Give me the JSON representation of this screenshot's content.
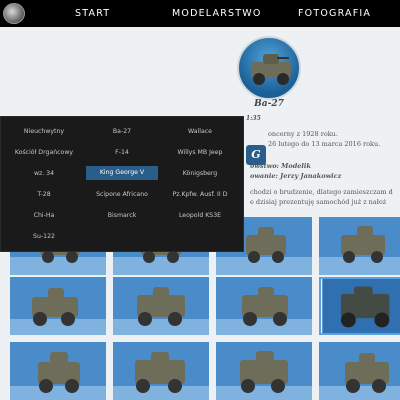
{
  "nav": {
    "items": [
      {
        "label": "START"
      },
      {
        "label": "MODELARSTWO"
      },
      {
        "label": "FOTOGRAFIA"
      }
    ]
  },
  "article": {
    "title": "Ba-27",
    "scale": "1:35",
    "badge": "G",
    "lines": [
      "oncerny z 1928 roku.",
      "26 lutego do 13 marca 2016 roku.",
      "owstwo: Modelik",
      "owanie: Jerzy Janakowicz",
      "chodzi o brudzenie, dlatego zamieszczam d",
      "e dzisiaj prezentuję samochód już z nałoż"
    ]
  },
  "dropdown": {
    "items": [
      {
        "label": "Nieuchwytny",
        "active": false
      },
      {
        "label": "Ba-27",
        "active": false
      },
      {
        "label": "Wallace",
        "active": false
      },
      {
        "label": "Kościół Drgańcowy",
        "active": false
      },
      {
        "label": "F-14",
        "active": false
      },
      {
        "label": "Willys MB Jeep",
        "active": false
      },
      {
        "label": "wz. 34",
        "active": false
      },
      {
        "label": "King George V",
        "active": true
      },
      {
        "label": "Königsberg",
        "active": false
      },
      {
        "label": "T-28",
        "active": false
      },
      {
        "label": "Scipone Africano",
        "active": false
      },
      {
        "label": "Pz.Kpfw. Ausf. II D",
        "active": false
      },
      {
        "label": "Chi-Ha",
        "active": false
      },
      {
        "label": "Bismarck",
        "active": false
      },
      {
        "label": "Leopold KS3E",
        "active": false
      },
      {
        "label": "Su-122",
        "active": false
      }
    ]
  },
  "colors": {
    "accent": "#2a5d8a",
    "nav_bg": "#000000",
    "dropdown_bg": "#1a1a1a",
    "photo_bg": "#3f7fc0"
  }
}
